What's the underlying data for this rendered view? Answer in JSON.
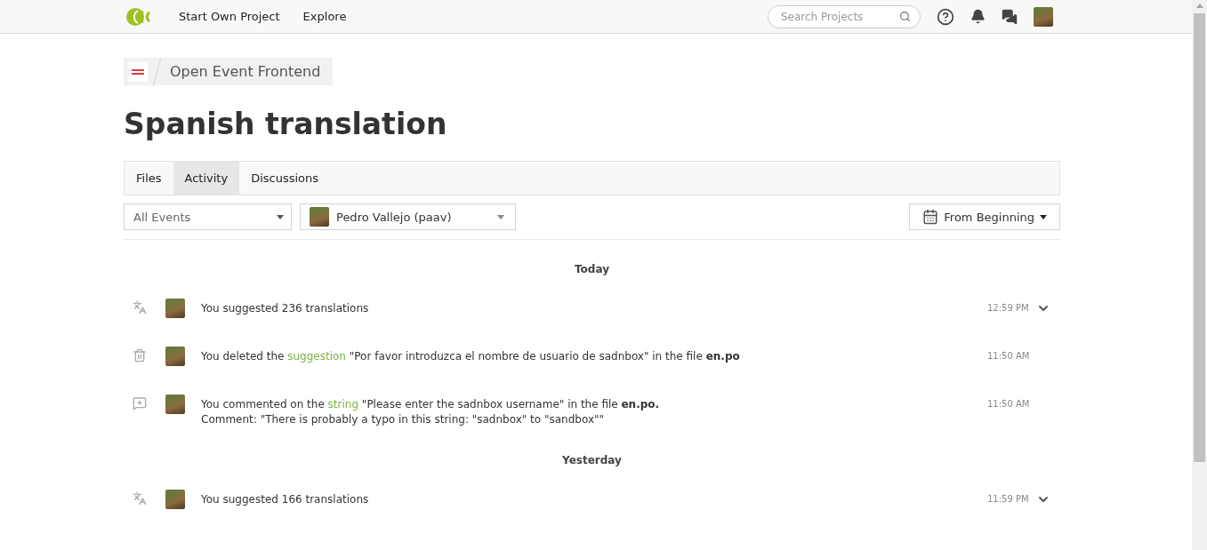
{
  "nav": {
    "links": [
      {
        "label": "Start Own Project"
      },
      {
        "label": "Explore"
      }
    ],
    "search": {
      "placeholder": "Search Projects"
    }
  },
  "breadcrumb": {
    "project": "Open Event Frontend"
  },
  "title": "Spanish translation",
  "tabs": [
    {
      "label": "Files",
      "selected": false
    },
    {
      "label": "Activity",
      "selected": true
    },
    {
      "label": "Discussions",
      "selected": false
    }
  ],
  "filters": {
    "events": "All Events",
    "user": "Pedro Vallejo (paav)",
    "date": "From Beginning"
  },
  "groups": [
    {
      "heading": "Today",
      "events": [
        {
          "kind": "suggested",
          "parts": [
            {
              "text": "You suggested 236 translations"
            }
          ],
          "time": "12:59 PM",
          "expandable": true
        },
        {
          "kind": "deleted",
          "parts": [
            {
              "text": "You deleted the "
            },
            {
              "link": "suggestion"
            },
            {
              "text": " \"Por favor introduzca el nombre de usuario de sadnbox\" in the file "
            },
            {
              "bold": "en.po"
            }
          ],
          "time": "11:50 AM",
          "expandable": false
        },
        {
          "kind": "commented",
          "parts": [
            {
              "text": "You commented on the "
            },
            {
              "link": "string"
            },
            {
              "text": " \"Please enter the sadnbox username\" in the file "
            },
            {
              "bold": "en.po."
            }
          ],
          "comment": "Comment: \"There is probably a typo in this string: \"sadnbox\" to \"sandbox\"\"",
          "time": "11:50 AM",
          "expandable": false
        }
      ]
    },
    {
      "heading": "Yesterday",
      "events": [
        {
          "kind": "suggested",
          "parts": [
            {
              "text": "You suggested 166 translations"
            }
          ],
          "time": "11:59 PM",
          "expandable": true
        }
      ]
    }
  ]
}
